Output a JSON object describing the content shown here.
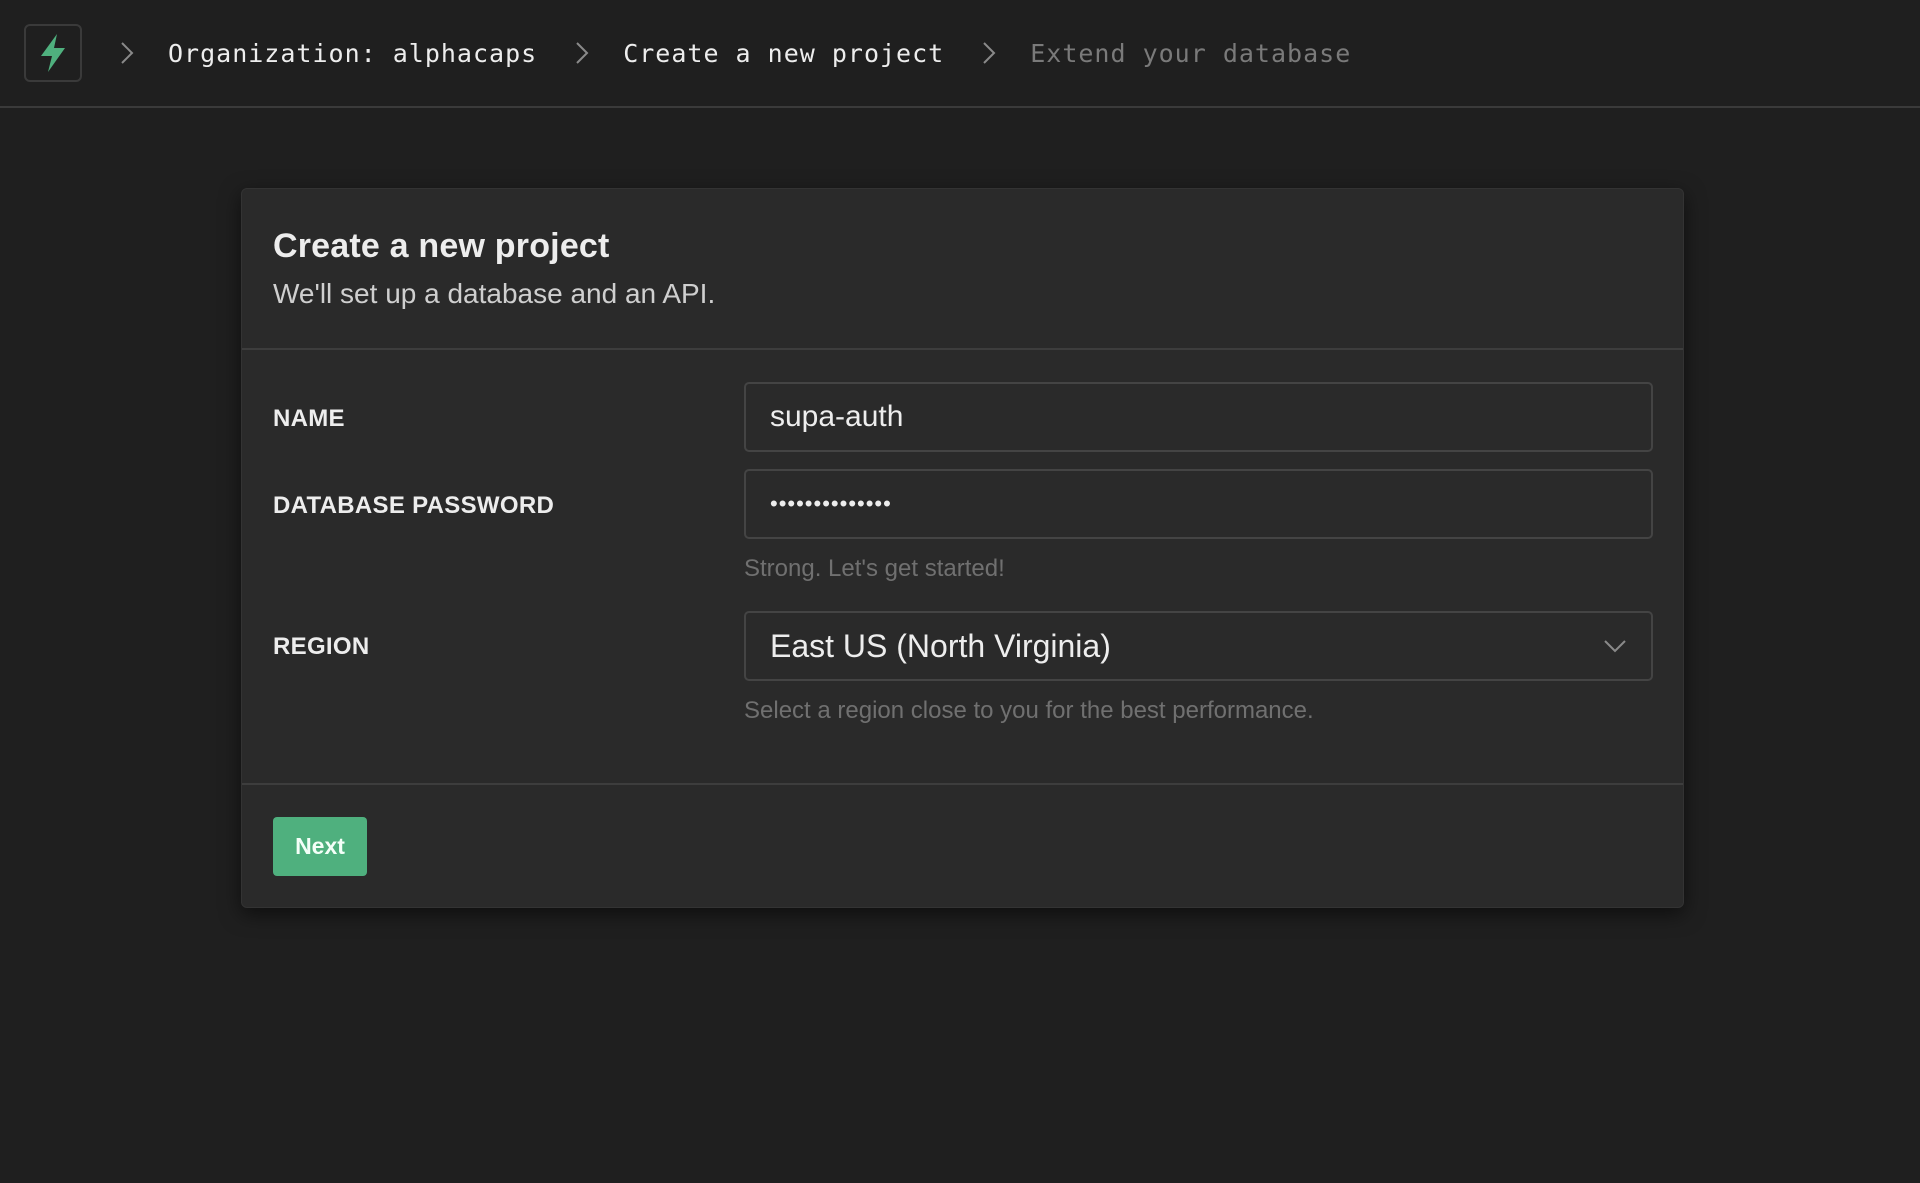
{
  "colors": {
    "accent": "#4fb07e",
    "background": "#1f1f1f",
    "card": "#2a2a2a"
  },
  "header": {
    "logo_icon": "lightning-bolt-icon",
    "breadcrumbs": [
      {
        "label": "Organization: alphacaps"
      },
      {
        "label": "Create a new project"
      },
      {
        "label": "Extend your database"
      }
    ],
    "separator_icon": "chevron-right-icon"
  },
  "form": {
    "title": "Create a new project",
    "subtitle": "We'll set up a database and an API.",
    "name": {
      "label": "NAME",
      "value": "supa-auth"
    },
    "password": {
      "label": "DATABASE PASSWORD",
      "value": "••••••••••••••",
      "help": "Strong. Let's get started!"
    },
    "region": {
      "label": "REGION",
      "value": "East US (North Virginia)",
      "help": "Select a region close to you for the best performance.",
      "icon": "chevron-down-icon"
    },
    "submit_label": "Next"
  }
}
